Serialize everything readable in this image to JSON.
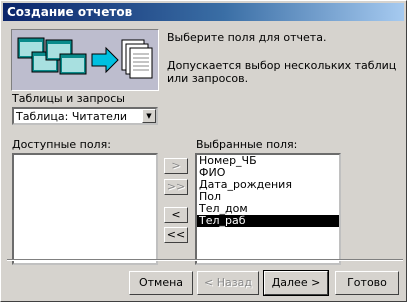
{
  "window": {
    "title": "Создание отчетов"
  },
  "description": {
    "line1": "Выберите поля для отчета.",
    "line2": "Допускается выбор нескольких таблиц или запросов."
  },
  "tables": {
    "label": "Таблицы и запросы",
    "selected": "Таблица: Читатели"
  },
  "available": {
    "label": "Доступные поля:",
    "items": []
  },
  "selected_fields": {
    "label": "Выбранные поля:",
    "items": [
      "Номер_ЧБ",
      "ФИО",
      "Дата_рождения",
      "Пол",
      "Тел_дом",
      "Тел_раб"
    ],
    "selected_index": 5
  },
  "move_buttons": {
    "add": ">",
    "add_all": ">>",
    "remove": "<",
    "remove_all": "<<"
  },
  "buttons": {
    "cancel": "Отмена",
    "back": "< Назад",
    "next": "Далее >",
    "finish": "Готово"
  }
}
